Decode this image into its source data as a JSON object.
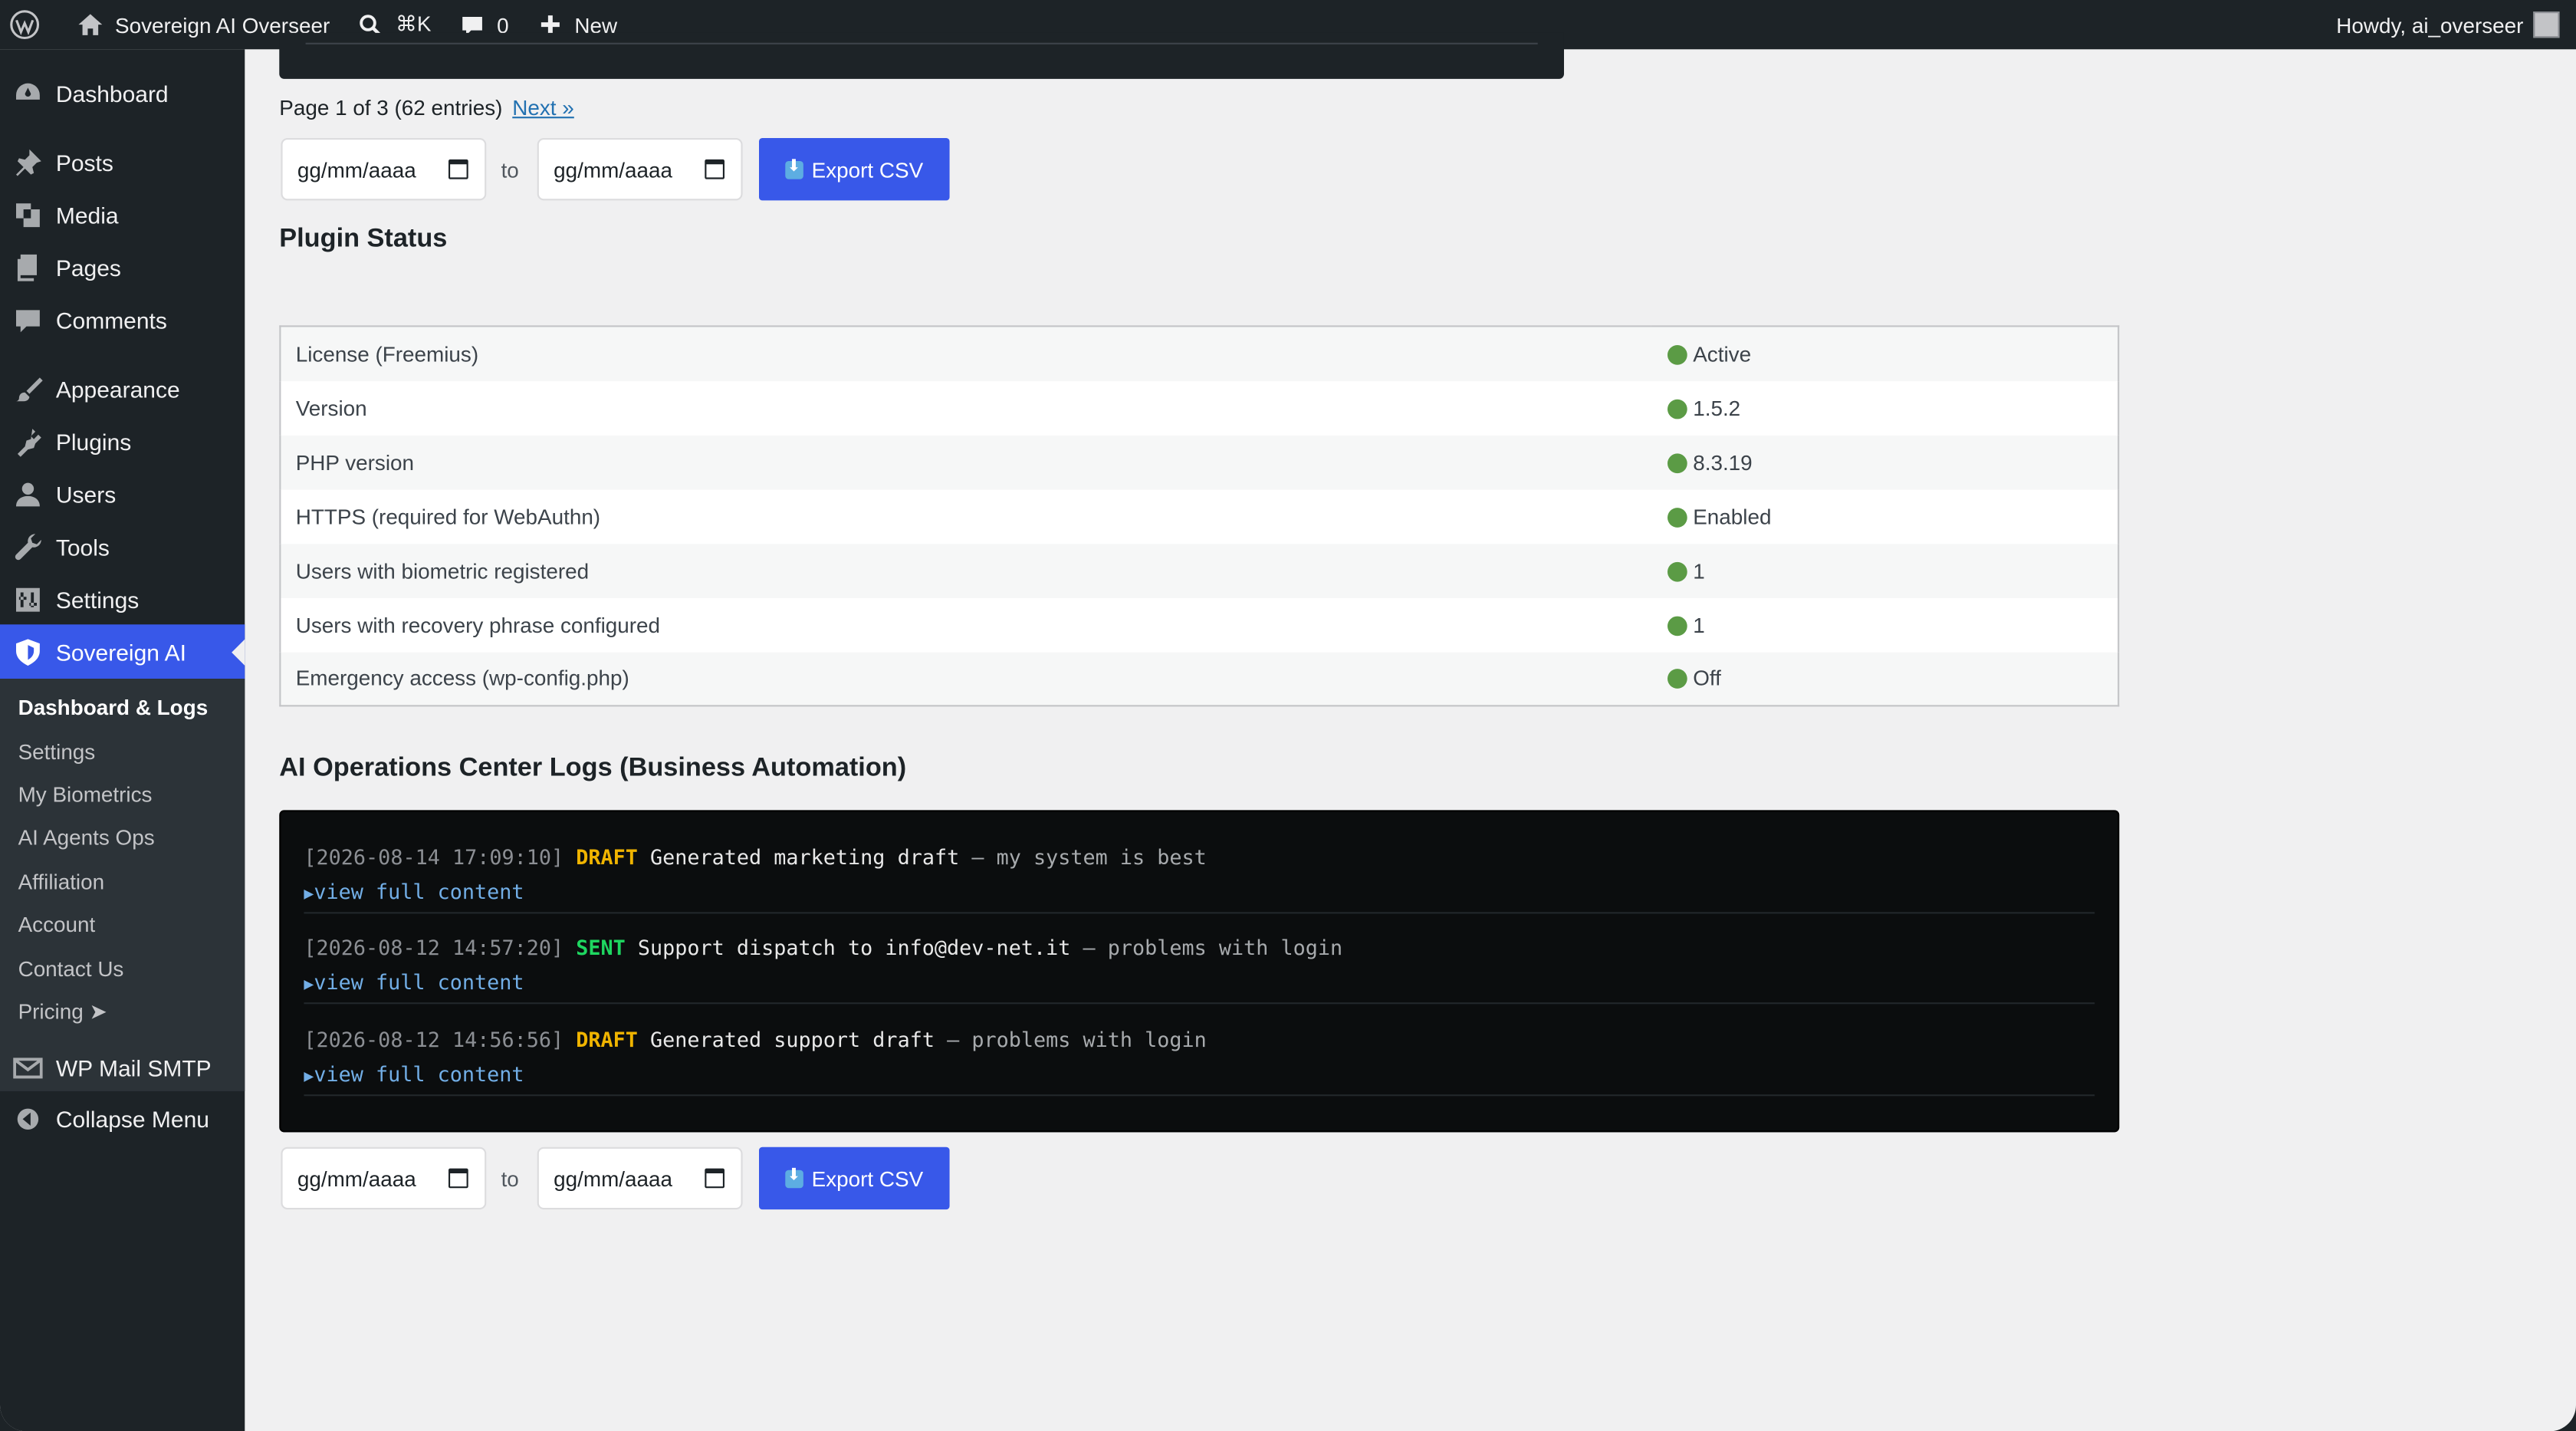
{
  "adminbar": {
    "site_name": "Sovereign AI Overseer",
    "search_shortcut": "⌘K",
    "comments_count": "0",
    "new_label": "New",
    "howdy": "Howdy, ai_overseer"
  },
  "sidebar": {
    "items": [
      {
        "label": "Dashboard",
        "icon": "dashboard-icon"
      },
      {
        "label": "Posts",
        "icon": "pin-icon"
      },
      {
        "label": "Media",
        "icon": "media-icon"
      },
      {
        "label": "Pages",
        "icon": "pages-icon"
      },
      {
        "label": "Comments",
        "icon": "comment-icon"
      },
      {
        "label": "Appearance",
        "icon": "brush-icon"
      },
      {
        "label": "Plugins",
        "icon": "plugin-icon"
      },
      {
        "label": "Users",
        "icon": "user-icon"
      },
      {
        "label": "Tools",
        "icon": "wrench-icon"
      },
      {
        "label": "Settings",
        "icon": "settings-icon"
      },
      {
        "label": "Sovereign AI",
        "icon": "shield-icon"
      },
      {
        "label": "WP Mail SMTP",
        "icon": "mail-icon"
      },
      {
        "label": "Collapse Menu",
        "icon": "collapse-icon"
      }
    ],
    "submenu": [
      "Dashboard & Logs",
      "Settings",
      "My Biometrics",
      "AI Agents Ops",
      "Affiliation",
      "Account",
      "Contact Us",
      "Pricing ➤"
    ]
  },
  "pager": {
    "text": "Page 1 of 3 (62 entries)",
    "next": "Next »"
  },
  "filters": {
    "date_placeholder": "gg/mm/aaaa",
    "to": "to",
    "export": "Export CSV"
  },
  "plugin_status": {
    "title": "Plugin Status",
    "rows": [
      {
        "label": "License (Freemius)",
        "value": "Active",
        "status_color": "#5b9b45"
      },
      {
        "label": "Version",
        "value": "1.5.2",
        "status_color": "#5b9b45"
      },
      {
        "label": "PHP version",
        "value": "8.3.19",
        "status_color": "#5b9b45"
      },
      {
        "label": "HTTPS (required for WebAuthn)",
        "value": "Enabled",
        "status_color": "#5b9b45"
      },
      {
        "label": "Users with biometric registered",
        "value": "1",
        "status_color": "#5b9b45"
      },
      {
        "label": "Users with recovery phrase configured",
        "value": "1",
        "status_color": "#5b9b45"
      },
      {
        "label": "Emergency access (wp-config.php)",
        "value": "Off",
        "status_color": "#5b9b45"
      }
    ]
  },
  "ops_logs": {
    "title": "AI Operations Center Logs (Business Automation)",
    "view_label": "view full content",
    "entries": [
      {
        "timestamp": "[2026-08-14 17:09:10]",
        "tag": "DRAFT",
        "message": "Generated marketing draft",
        "detail": "my system is best"
      },
      {
        "timestamp": "[2026-08-12 14:57:20]",
        "tag": "SENT",
        "message": "Support dispatch to info@dev-net.it",
        "detail": "problems with login"
      },
      {
        "timestamp": "[2026-08-12 14:56:56]",
        "tag": "DRAFT",
        "message": "Generated support draft",
        "detail": "problems with login"
      }
    ]
  },
  "colors": {
    "accent": "#3858e9",
    "draft": "#f0b400",
    "sent": "#1ed760",
    "ok": "#5b9b45"
  }
}
